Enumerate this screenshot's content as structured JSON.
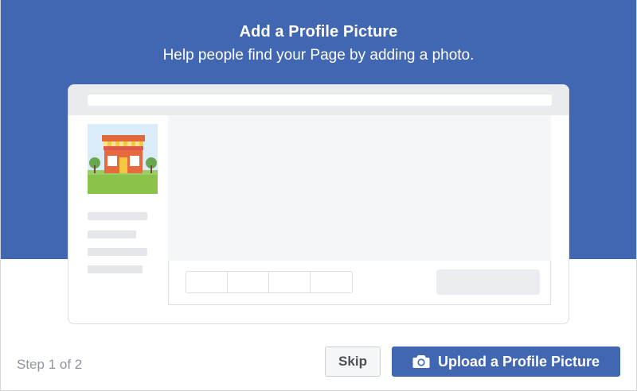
{
  "header": {
    "title": "Add a Profile Picture",
    "subtitle": "Help people find your Page by adding a photo."
  },
  "footer": {
    "step_text": "Step 1 of 2",
    "skip_label": "Skip",
    "upload_label": "Upload a Profile Picture"
  },
  "icons": {
    "upload": "camera-icon",
    "illustration": "storefront-illustration"
  },
  "colors": {
    "brand_blue": "#4267b2",
    "skip_bg": "#f5f6f7",
    "step_text": "#90949c"
  }
}
